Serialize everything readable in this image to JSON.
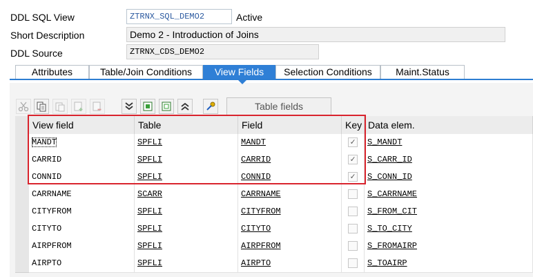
{
  "header": {
    "ddl_sql_view": {
      "label": "DDL SQL View",
      "value": "ZTRNX_SQL_DEMO2",
      "status": "Active"
    },
    "short_description": {
      "label": "Short Description",
      "value": "Demo 2 - Introduction of Joins"
    },
    "ddl_source": {
      "label": "DDL Source",
      "value": "ZTRNX_CDS_DEMO2"
    }
  },
  "tabs": [
    {
      "label": "Attributes",
      "active": false
    },
    {
      "label": "Table/Join Conditions",
      "active": false
    },
    {
      "label": "View Fields",
      "active": true
    },
    {
      "label": "Selection Conditions",
      "active": false
    },
    {
      "label": "Maint.Status",
      "active": false
    }
  ],
  "toolbar": {
    "icons": [
      "cut-icon",
      "copy-icon",
      "paste-icon",
      "insert-row-icon",
      "delete-row-icon",
      "scroll-down-icon",
      "select-all-icon",
      "deselect-all-icon",
      "scroll-up-icon",
      "wizard-key-icon"
    ],
    "table_fields_label": "Table fields"
  },
  "grid": {
    "columns": [
      "View field",
      "Table",
      "Field",
      "Key",
      "Data elem."
    ],
    "rows": [
      {
        "view_field": "MANDT",
        "table": "SPFLI",
        "field": "MANDT",
        "key": true,
        "data_elem": "S_MANDT"
      },
      {
        "view_field": "CARRID",
        "table": "SPFLI",
        "field": "CARRID",
        "key": true,
        "data_elem": "S_CARR_ID"
      },
      {
        "view_field": "CONNID",
        "table": "SPFLI",
        "field": "CONNID",
        "key": true,
        "data_elem": "S_CONN_ID"
      },
      {
        "view_field": "CARRNAME",
        "table": "SCARR",
        "field": "CARRNAME",
        "key": false,
        "data_elem": "S_CARRNAME"
      },
      {
        "view_field": "CITYFROM",
        "table": "SPFLI",
        "field": "CITYFROM",
        "key": false,
        "data_elem": "S_FROM_CIT"
      },
      {
        "view_field": "CITYTO",
        "table": "SPFLI",
        "field": "CITYTO",
        "key": false,
        "data_elem": "S_TO_CITY"
      },
      {
        "view_field": "AIRPFROM",
        "table": "SPFLI",
        "field": "AIRPFROM",
        "key": false,
        "data_elem": "S_FROMAIRP"
      },
      {
        "view_field": "AIRPTO",
        "table": "SPFLI",
        "field": "AIRPTO",
        "key": false,
        "data_elem": "S_TOAIRP"
      }
    ]
  },
  "colors": {
    "accent": "#2f7fd6",
    "highlight_border": "#d9232d",
    "link": "#2c5aa0"
  }
}
